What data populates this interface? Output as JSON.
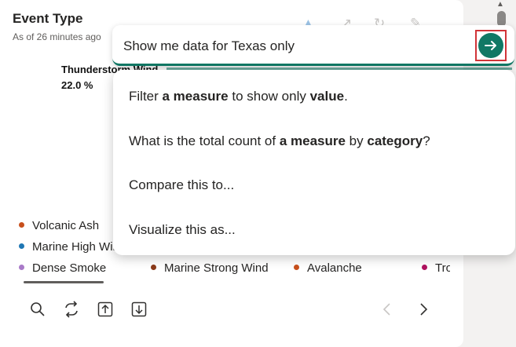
{
  "card": {
    "title": "Event Type",
    "subtitle": "As of 26 minutes ago",
    "highlight_label": "Thunderstorm Wind",
    "highlight_value": "22.0 %"
  },
  "legend": {
    "items": [
      {
        "label": "Volcanic Ash",
        "color": "#c8501c"
      },
      {
        "label": "Marine High Wind",
        "color": "#1f77b4"
      },
      {
        "label": "Dense Smoke",
        "color": "#a97ac8"
      },
      {
        "label": "Marine Strong Wind",
        "color": "#8b3a1a"
      },
      {
        "label": "Avalanche",
        "color": "#c8501c"
      },
      {
        "label": "Tropical Storm",
        "color": "#b0125f"
      }
    ]
  },
  "qa": {
    "input_value": "Show me data for Texas only",
    "accent_color": "#117865"
  },
  "suggestions": [
    {
      "parts": [
        {
          "t": "Filter "
        },
        {
          "t": "a measure",
          "b": true
        },
        {
          "t": " to show only "
        },
        {
          "t": "value",
          "b": true
        },
        {
          "t": "."
        }
      ]
    },
    {
      "parts": [
        {
          "t": "What is the total count of "
        },
        {
          "t": "a measure",
          "b": true
        },
        {
          "t": " by "
        },
        {
          "t": "category",
          "b": true
        },
        {
          "t": "?"
        }
      ]
    },
    {
      "parts": [
        {
          "t": "Compare this to..."
        }
      ]
    },
    {
      "parts": [
        {
          "t": "Visualize this as..."
        }
      ]
    }
  ],
  "toolbar": {
    "icons": [
      "search-icon",
      "switch-icon",
      "upload-icon",
      "download-icon"
    ],
    "nav": [
      "chevron-left-icon",
      "chevron-right-icon"
    ]
  }
}
